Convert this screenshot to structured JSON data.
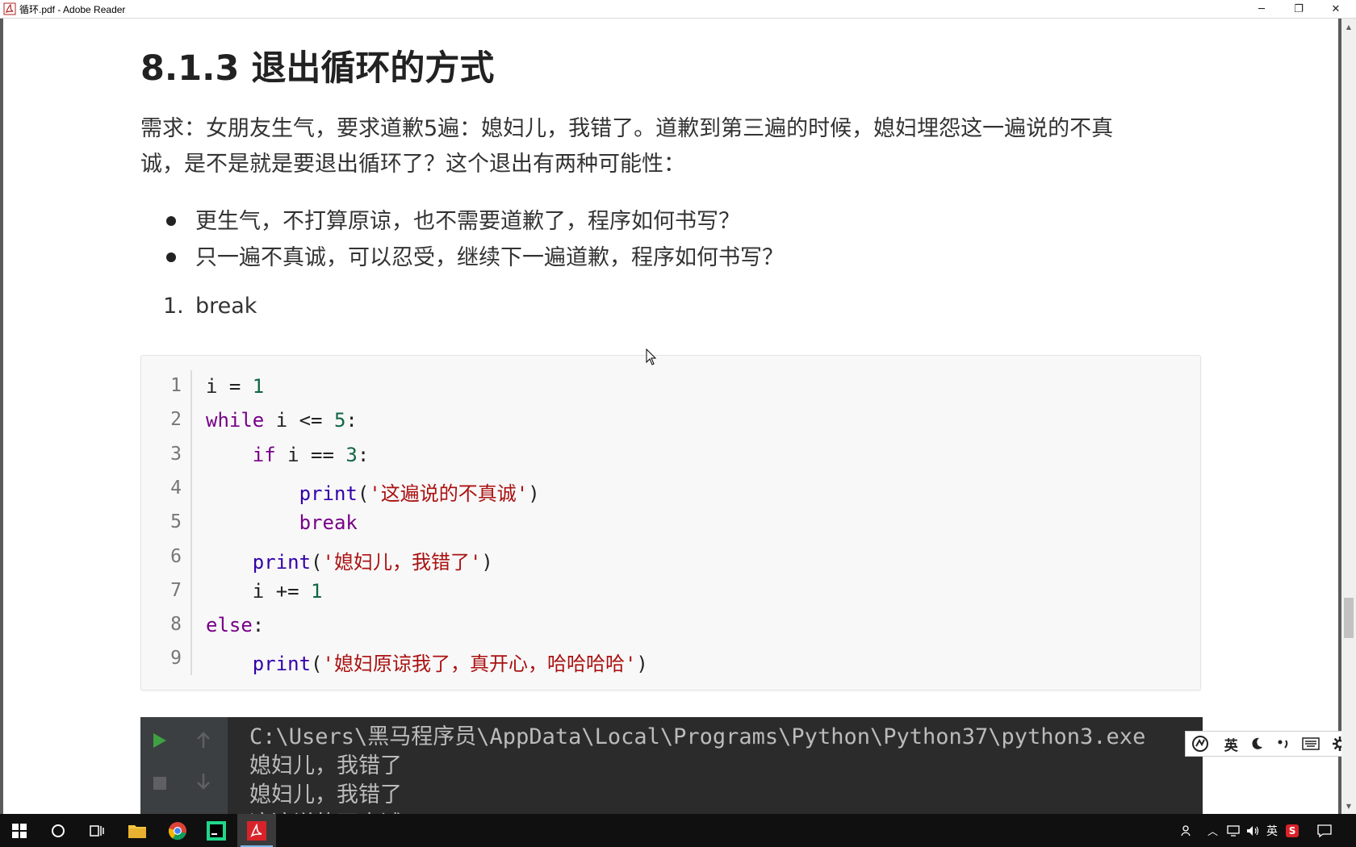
{
  "window": {
    "title": "循环.pdf - Adobe Reader",
    "minimize": "─",
    "restore": "❐",
    "close": "✕"
  },
  "document": {
    "heading": "8.1.3 退出循环的方式",
    "paragraph_line1": "需求：女朋友生气，要求道歉5遍：媳妇儿，我错了。道歉到第三遍的时候，媳妇埋怨这一遍说的不真",
    "paragraph_line2": "诚，是不是就是要退出循环了？这个退出有两种可能性：",
    "bullets": [
      "更生气，不打算原谅，也不需要道歉了，程序如何书写？",
      "只一遍不真诚，可以忍受，继续下一遍道歉，程序如何书写？"
    ],
    "numbered_item": {
      "number": "1.",
      "text": "break"
    },
    "code": {
      "line_numbers": [
        "1",
        "2",
        "3",
        "4",
        "5",
        "6",
        "7",
        "8",
        "9"
      ],
      "lines": [
        [
          {
            "t": "i = ",
            "c": ""
          },
          {
            "t": "1",
            "c": "num-lit"
          }
        ],
        [
          {
            "t": "while",
            "c": "kw"
          },
          {
            "t": " i <= ",
            "c": ""
          },
          {
            "t": "5",
            "c": "num-lit"
          },
          {
            "t": ":",
            "c": ""
          }
        ],
        [
          {
            "t": "    ",
            "c": ""
          },
          {
            "t": "if",
            "c": "kw"
          },
          {
            "t": " i == ",
            "c": ""
          },
          {
            "t": "3",
            "c": "num-lit"
          },
          {
            "t": ":",
            "c": ""
          }
        ],
        [
          {
            "t": "        ",
            "c": ""
          },
          {
            "t": "print",
            "c": "bi"
          },
          {
            "t": "(",
            "c": ""
          },
          {
            "t": "'这遍说的不真诚'",
            "c": "str"
          },
          {
            "t": ")",
            "c": ""
          }
        ],
        [
          {
            "t": "        ",
            "c": ""
          },
          {
            "t": "break",
            "c": "kw"
          }
        ],
        [
          {
            "t": "    ",
            "c": ""
          },
          {
            "t": "print",
            "c": "bi"
          },
          {
            "t": "(",
            "c": ""
          },
          {
            "t": "'媳妇儿，我错了'",
            "c": "str"
          },
          {
            "t": ")",
            "c": ""
          }
        ],
        [
          {
            "t": "    i += ",
            "c": ""
          },
          {
            "t": "1",
            "c": "num-lit"
          }
        ],
        [
          {
            "t": "else",
            "c": "kw"
          },
          {
            "t": ":",
            "c": ""
          }
        ],
        [
          {
            "t": "    ",
            "c": ""
          },
          {
            "t": "print",
            "c": "bi"
          },
          {
            "t": "(",
            "c": ""
          },
          {
            "t": "'媳妇原谅我了，真开心，哈哈哈哈'",
            "c": "str"
          },
          {
            "t": ")",
            "c": ""
          }
        ]
      ]
    }
  },
  "terminal": {
    "lines": [
      "C:\\Users\\黑马程序员\\AppData\\Local\\Programs\\Python\\Python37\\python3.exe",
      "媳妇儿，我错了",
      "媳妇儿，我错了",
      "这遍说的不真诚"
    ]
  },
  "ime": {
    "mode": "英",
    "icons": [
      "ime-logo-icon",
      "moon-icon",
      "punctuation-icon",
      "keyboard-icon",
      "gear-icon"
    ]
  },
  "taskbar": {
    "tray_lang": "英",
    "tray_app": "S"
  },
  "colors": {
    "accent_blue": "#76b9ed",
    "terminal_bg": "#2b2b2b",
    "run_green": "#3fa142",
    "pdf_red": "#d8232a"
  }
}
